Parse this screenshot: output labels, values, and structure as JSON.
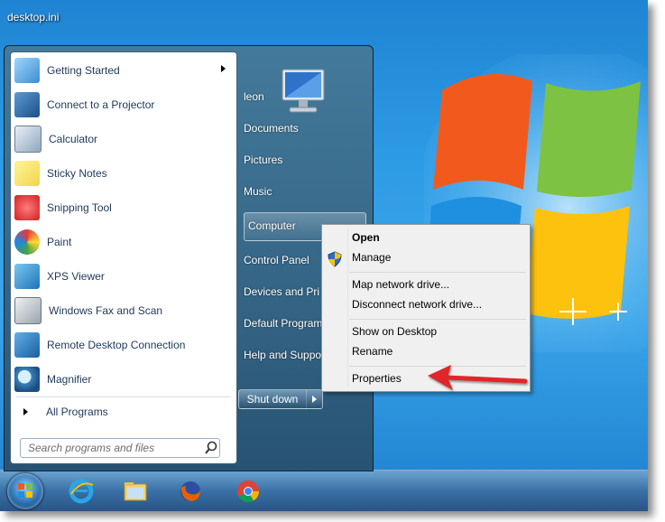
{
  "desktop": {
    "label": "desktop.ini"
  },
  "start_menu": {
    "programs": [
      {
        "label": "Getting Started",
        "icon": "getting-started-icon",
        "has_submenu": true
      },
      {
        "label": "Connect to a Projector",
        "icon": "projector-icon"
      },
      {
        "label": "Calculator",
        "icon": "calculator-icon"
      },
      {
        "label": "Sticky Notes",
        "icon": "sticky-notes-icon"
      },
      {
        "label": "Snipping Tool",
        "icon": "snipping-tool-icon"
      },
      {
        "label": "Paint",
        "icon": "paint-icon"
      },
      {
        "label": "XPS Viewer",
        "icon": "xps-viewer-icon"
      },
      {
        "label": "Windows Fax and Scan",
        "icon": "fax-scan-icon"
      },
      {
        "label": "Remote Desktop Connection",
        "icon": "remote-desktop-icon"
      },
      {
        "label": "Magnifier",
        "icon": "magnifier-icon"
      }
    ],
    "all_programs": "All Programs",
    "search_placeholder": "Search programs and files",
    "right_items": [
      "leon",
      "Documents",
      "Pictures",
      "Music",
      "Computer",
      "Control Panel",
      "Devices and Pri",
      "Default Program",
      "Help and Suppo"
    ],
    "shutdown_label": "Shut down"
  },
  "context_menu": {
    "items": [
      "Open",
      "Manage",
      "Map network drive...",
      "Disconnect network drive...",
      "Show on Desktop",
      "Rename",
      "Properties"
    ]
  },
  "taskbar": {
    "icons": [
      "ie-icon",
      "explorer-folder-icon",
      "firefox-icon",
      "chrome-icon"
    ]
  },
  "colors": {
    "arrow": "#e0262a",
    "menu_text": "#1e395b"
  }
}
